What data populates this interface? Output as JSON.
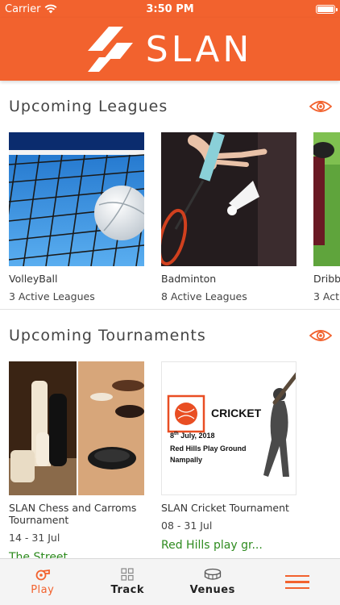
{
  "status_bar": {
    "carrier": "Carrier",
    "time": "3:50 PM"
  },
  "header": {
    "logo_text": "SLAN",
    "brand_color": "#f2622e"
  },
  "leagues": {
    "title": "Upcoming Leagues",
    "view_icon": "eye-icon",
    "cards": [
      {
        "title": "VolleyBall",
        "subtitle": "3 Active Leagues"
      },
      {
        "title": "Badminton",
        "subtitle": "8 Active Leagues"
      },
      {
        "title": "Dribb",
        "subtitle": "3 Acti"
      }
    ]
  },
  "tournaments": {
    "title": "Upcoming Tournaments",
    "view_icon": "eye-icon",
    "cards": [
      {
        "title": "SLAN Chess and Carroms Tournament",
        "dates": "14 - 31 Jul",
        "venue": "The Street"
      },
      {
        "title": "SLAN Cricket Tournament",
        "dates": "08 - 31 Jul",
        "venue": "Red Hills play gr...",
        "poster": {
          "heading": "CRICKET",
          "date_day": "8",
          "date_suffix": "th",
          "date_rest": " July, 2018",
          "place_line1": "Red Hills Play Ground",
          "place_line2": "Nampally"
        }
      }
    ]
  },
  "tab_bar": {
    "items": [
      {
        "label": "Play",
        "icon": "whistle-icon",
        "active": true
      },
      {
        "label": "Track",
        "icon": "grid-icon",
        "active": false
      },
      {
        "label": "Venues",
        "icon": "stadium-icon",
        "active": false
      },
      {
        "label": "",
        "icon": "menu-icon",
        "active": false
      }
    ]
  },
  "colors": {
    "accent": "#f2622e",
    "link_green": "#2e8b1f"
  }
}
